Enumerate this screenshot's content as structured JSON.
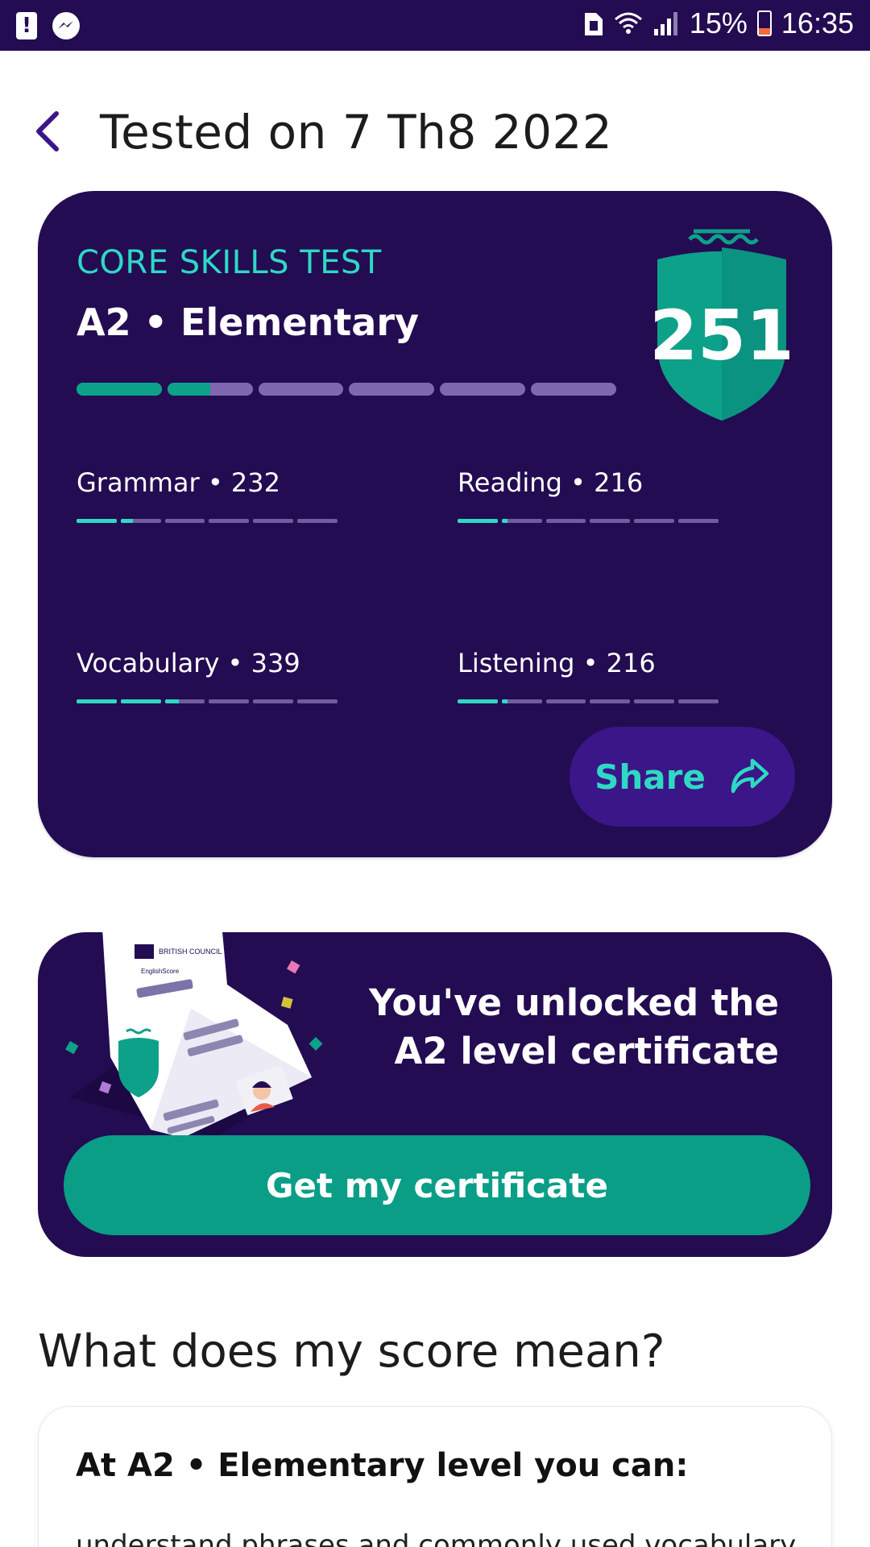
{
  "status_bar": {
    "battery_text": "15%",
    "time": "16:35"
  },
  "header": {
    "title": "Tested on 7 Th8 2022"
  },
  "score_card": {
    "test_name": "CORE SKILLS TEST",
    "level": "A2 • Elementary",
    "score": "251",
    "overall_progress_segments": [
      1,
      0.5,
      0,
      0,
      0,
      0
    ],
    "skills": [
      {
        "label": "Grammar • 232",
        "progress_segments": [
          1,
          0.3,
          0,
          0,
          0,
          0
        ]
      },
      {
        "label": "Reading • 216",
        "progress_segments": [
          1,
          0.15,
          0,
          0,
          0,
          0
        ]
      },
      {
        "label": "Vocabulary • 339",
        "progress_segments": [
          1,
          1,
          0.35,
          0,
          0,
          0
        ]
      },
      {
        "label": "Listening • 216",
        "progress_segments": [
          1,
          0.15,
          0,
          0,
          0,
          0
        ]
      }
    ],
    "share_label": "Share"
  },
  "certificate": {
    "message_line1": "You've unlocked the",
    "message_line2": "A2 level certificate",
    "button_label": "Get my certificate",
    "illustration_brand_text": "BRITISH COUNCIL",
    "illustration_product_text": "EnglishScore"
  },
  "score_meaning": {
    "title": "What does my score mean?",
    "heading": "At A2 • Elementary level you can:",
    "body": "understand phrases and commonly used vocabulary"
  },
  "colors": {
    "brand_dark": "#230c52",
    "accent_teal": "#2ed9c3",
    "button_teal": "#0a9e87",
    "share_button_bg": "#3a1688"
  }
}
